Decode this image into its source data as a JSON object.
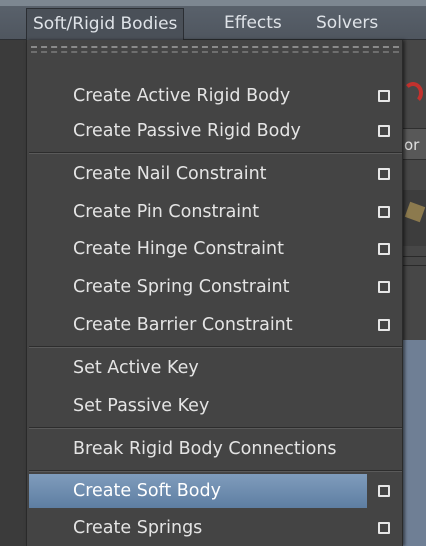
{
  "menubar": {
    "items": [
      {
        "label": "Soft/Rigid Bodies"
      },
      {
        "label": "Effects"
      },
      {
        "label": "Solvers"
      }
    ]
  },
  "dropdown": {
    "items": [
      {
        "label": "Create Active Rigid Body",
        "has_options": true
      },
      {
        "label": "Create Passive Rigid Body",
        "has_options": true
      },
      {
        "label": "Create Nail Constraint",
        "has_options": true
      },
      {
        "label": "Create Pin Constraint",
        "has_options": true
      },
      {
        "label": "Create Hinge Constraint",
        "has_options": true
      },
      {
        "label": "Create Spring Constraint",
        "has_options": true
      },
      {
        "label": "Create Barrier Constraint",
        "has_options": true
      },
      {
        "label": "Set Active Key",
        "has_options": false
      },
      {
        "label": "Set Passive Key",
        "has_options": false
      },
      {
        "label": "Break Rigid Body Connections",
        "has_options": false
      },
      {
        "label": "Create Soft Body",
        "has_options": true,
        "highlighted": true
      },
      {
        "label": "Create Springs",
        "has_options": true
      }
    ]
  },
  "background": {
    "partial_text": "or"
  },
  "colors": {
    "menu_bg": "#444444",
    "highlight": "#6f8db0",
    "menubar_bg": "#555d66"
  }
}
